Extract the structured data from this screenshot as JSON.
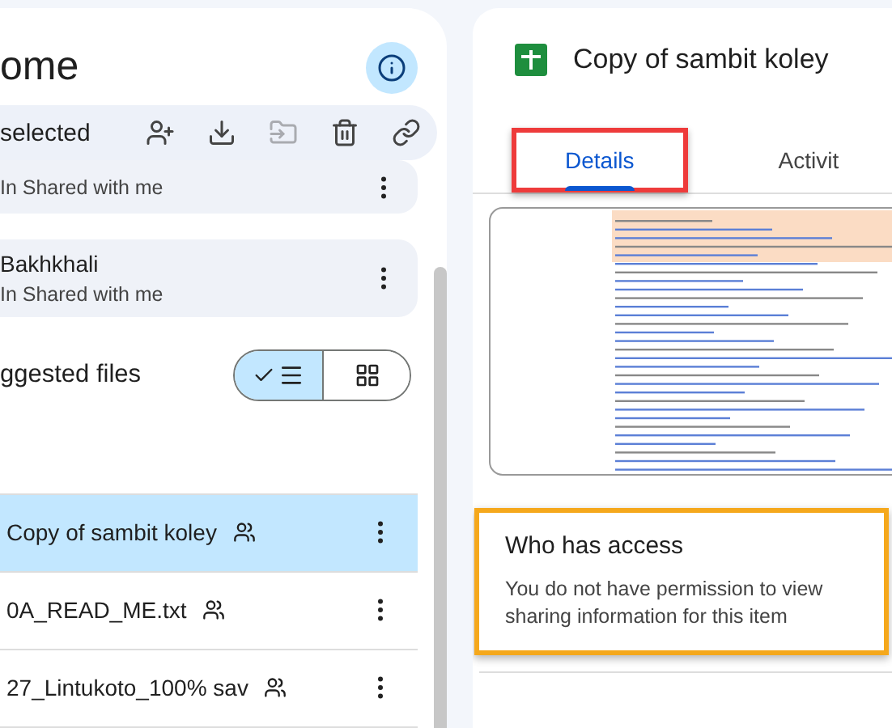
{
  "left_panel": {
    "title": "ome",
    "toolbar": {
      "label": "selected"
    },
    "cards": [
      {
        "subtitle": "In Shared with me"
      },
      {
        "title": "Bakhkhali",
        "subtitle": "In Shared with me"
      }
    ],
    "section_title": "ggested files",
    "view_toggle": [
      {
        "kind": "list",
        "selected": true
      },
      {
        "kind": "grid",
        "selected": false
      }
    ],
    "files": [
      {
        "name": "Copy of sambit koley",
        "shared": true,
        "selected": true
      },
      {
        "name": "0A_READ_ME.txt",
        "shared": true,
        "selected": false
      },
      {
        "name": "27_Lintukoto_100% sav",
        "shared": true,
        "selected": false
      }
    ]
  },
  "details_panel": {
    "file_title": "Copy of sambit koley",
    "tabs": [
      {
        "label": "Details",
        "selected": true,
        "highlighted": true
      },
      {
        "label": "Activit",
        "selected": false,
        "highlighted": false
      }
    ],
    "access": {
      "title": "Who has access",
      "message": "You do not have permission to view sharing information for this item",
      "highlighted": true
    }
  }
}
